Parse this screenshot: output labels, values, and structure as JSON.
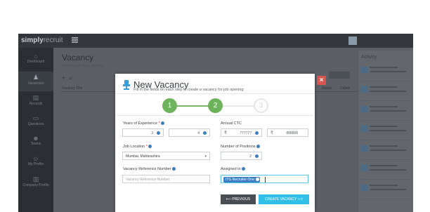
{
  "app": {
    "brand_main": "simply",
    "brand_sub": "recruit",
    "sidebar": [
      {
        "label": "Dashboard",
        "icon": "home-icon"
      },
      {
        "label": "Vacancies",
        "icon": "chair-icon"
      },
      {
        "label": "Records",
        "icon": "file-icon"
      },
      {
        "label": "Questions",
        "icon": "chat-icon"
      },
      {
        "label": "Teams",
        "icon": "group-icon"
      },
      {
        "label": "My Profile",
        "icon": "user-icon"
      },
      {
        "label": "Company Profile",
        "icon": "building-icon"
      }
    ],
    "page_title": "Vacancy",
    "page_subtitle": "Select or create a vacancy",
    "column_headers": [
      "Vacancy Title",
      "Status",
      "Delete"
    ],
    "activity_title": "Activity"
  },
  "modal": {
    "title": "New Vacancy",
    "subtitle": "Fill in the fields on each step to create a vacancy for job opening",
    "steps": [
      "1",
      "2",
      "3"
    ],
    "years_label": "Years of Experience",
    "years_required": "*",
    "years_min": "3",
    "years_max": "4",
    "ctc_label": "Annual CTC",
    "currency_symbol": "₹",
    "ctc_min": "777777",
    "ctc_max": "888888",
    "location_label": "Job Location",
    "location_required": "*",
    "location_value": "Mumbai, Maharashtra",
    "positions_label": "Number of Positions",
    "positions_value": "2",
    "ref_label": "Vacancy Reference Number",
    "ref_placeholder": "Vacancy Reference Number",
    "assigned_label": "Assigned to",
    "assigned_tag": "ITG Recruiter One",
    "prev_button": "PREVIOUS",
    "create_button": "CREATE VACANCY",
    "close_icon": "×"
  },
  "colors": {
    "step_done": "#6db35c",
    "primary_button": "#33c0e8",
    "secondary_button": "#4a4f55",
    "close_button": "#d9534f",
    "tag": "#3a7fc1"
  }
}
